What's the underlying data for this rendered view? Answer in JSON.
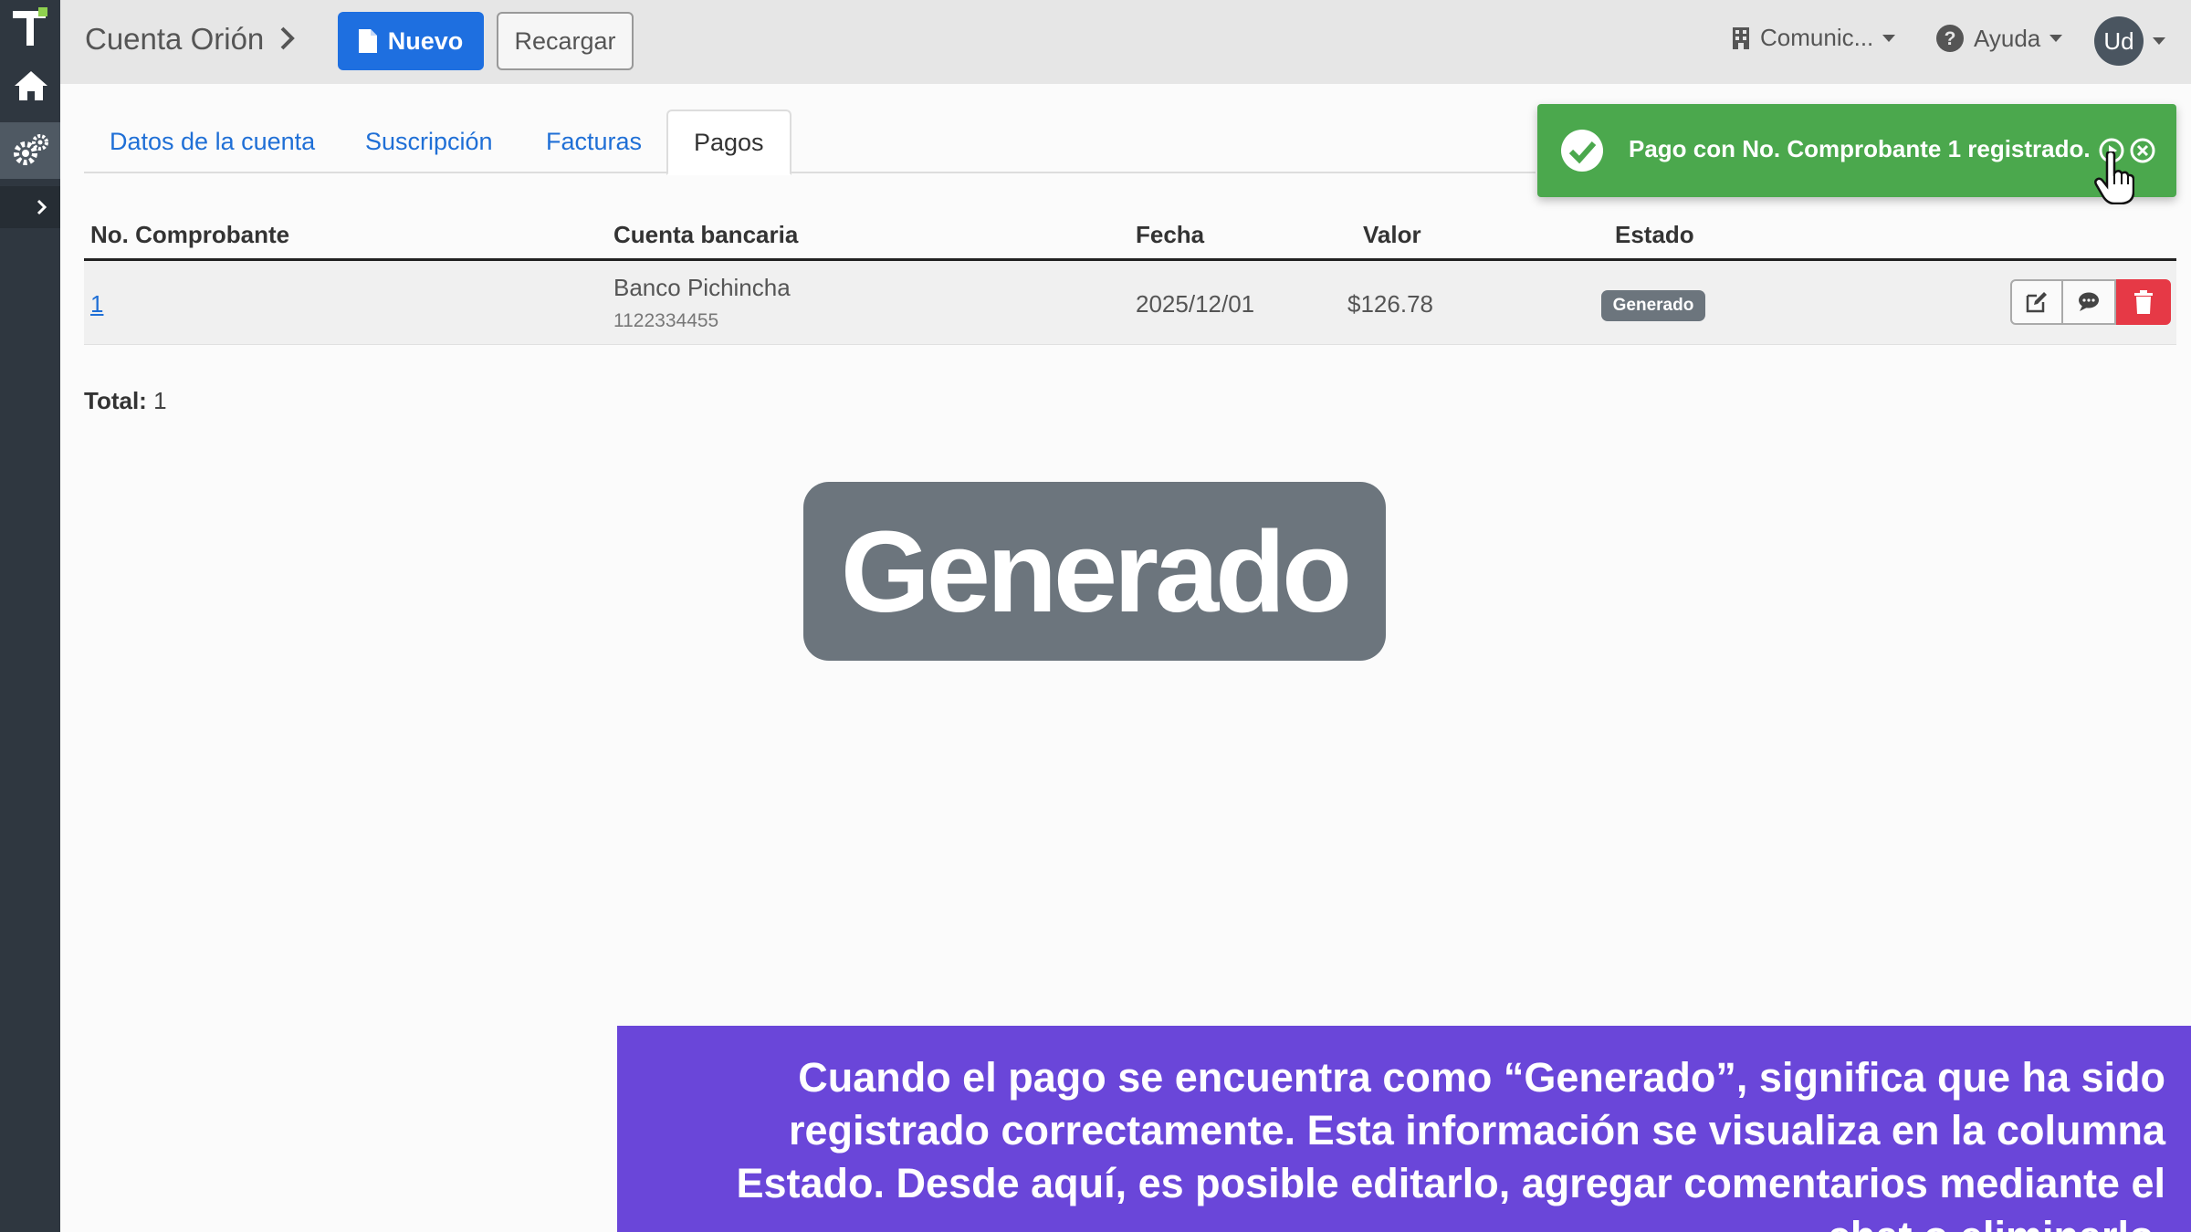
{
  "header": {
    "account_name": "Cuenta Orión",
    "new_button": "Nuevo",
    "reload_button": "Recargar",
    "community_menu": "Comunic...",
    "help_menu": "Ayuda",
    "user_initials": "Ud"
  },
  "tabs": [
    {
      "label": "Datos de la cuenta"
    },
    {
      "label": "Suscripción"
    },
    {
      "label": "Facturas"
    },
    {
      "label": "Pagos",
      "active": true
    }
  ],
  "toast": {
    "message": "Pago con No. Comprobante 1 registrado.",
    "color": "#4ba84d"
  },
  "table": {
    "headers": {
      "receipt": "No. Comprobante",
      "bank_account": "Cuenta bancaria",
      "date": "Fecha",
      "value": "Valor",
      "status": "Estado"
    },
    "rows": [
      {
        "receipt": "1",
        "bank": "Banco Pichincha",
        "account_number": "1122334455",
        "date": "2025/12/01",
        "value": "$126.78",
        "status": "Generado"
      }
    ]
  },
  "total": {
    "label": "Total:",
    "value": "1"
  },
  "highlight": {
    "text": "Generado"
  },
  "caption": {
    "text": "Cuando el pago se encuentra como “Generado”, significa que ha sido registrado correctamente. Esta información se visualiza en la columna Estado. Desde aquí, es posible editarlo, agregar comentarios mediante el chat o eliminarlo."
  },
  "colors": {
    "primary": "#1e6fe0",
    "sidebar": "#2f3740",
    "badge": "#6c757d",
    "danger": "#e63946",
    "caption_bg": "#6a46d9"
  },
  "icons": [
    "app-logo-icon",
    "home-icon",
    "settings-icon",
    "chevron-right-icon",
    "file-icon",
    "building-icon",
    "help-icon",
    "check-circle-icon",
    "play-circle-icon",
    "close-circle-icon",
    "edit-icon",
    "chat-icon",
    "trash-icon",
    "hand-cursor-icon"
  ]
}
